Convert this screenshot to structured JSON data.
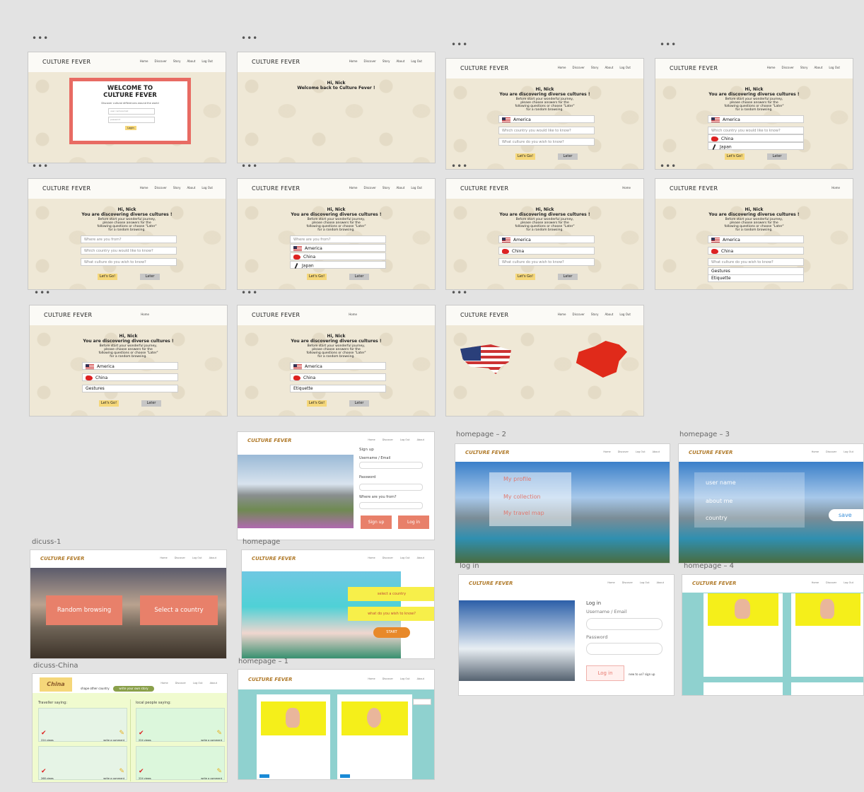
{
  "brand": "CULTURE FEVER",
  "brand_italic": "CULTURE FEVER",
  "dots": "•••",
  "nav_full": [
    "Home",
    "Discover",
    "Story",
    "About",
    "Log Out"
  ],
  "nav_home": "Home",
  "welcome": {
    "title_line1": "WELCOME TO",
    "title_line2": "CULTURE FEVER",
    "subtitle": "Discover cultural differences around the world",
    "username_ph": "user name/email",
    "password_ph": "password",
    "login": "Login"
  },
  "greeting": {
    "hi": "Hi, Nick",
    "welcome_back": "Welcome back to Culture Fever !",
    "discover": "You are discovering diverse cultures !",
    "desc": "Before start your wonderful journey, please choose answers for the following questions or choose \"Later\" for a random browsing."
  },
  "fields": {
    "where": "Where are you from?",
    "which": "Which country you would like to know?",
    "what": "What culture do you wish to know?"
  },
  "options": {
    "america": "America",
    "china": "China",
    "japan": "Japan",
    "gestures": "Gestures",
    "etiquette": "Etiquette"
  },
  "buttons": {
    "go": "Let's Go!",
    "later": "Later"
  },
  "labels": {
    "homepage2": "homepage – 2",
    "homepage3": "homepage – 3",
    "dicuss1": "dicuss-1",
    "homepage": "homepage",
    "login": "log in",
    "homepage4": "homepage – 4",
    "dicussChina": "dicuss-China",
    "homepage1": "homepage – 1"
  },
  "signup": {
    "title": "Sign up",
    "user": "Username / Email",
    "password": "Password",
    "where": "Where are you from?",
    "signup_btn": "Sign up",
    "login_btn": "Log in"
  },
  "menu": {
    "profile": "My profile",
    "collection": "My collection",
    "travel": "My travel map"
  },
  "profile_form": {
    "user": "user name",
    "about": "about me",
    "country": "country",
    "save": "save"
  },
  "discuss": {
    "random": "Random browsing",
    "select": "Select a country"
  },
  "homepage": {
    "select": "select a country",
    "what": "what do you wish to know?",
    "start": "START"
  },
  "login": {
    "title": "Log in",
    "user": "Username / Email",
    "password": "Password",
    "btn": "Log in",
    "new": "new to us? sign up"
  },
  "china": {
    "title": "China",
    "other": "shape other country",
    "write": "write your own story",
    "traveler": "Traveller saying:",
    "local": "local people saying:",
    "views1": "224 views",
    "views2": "268 views",
    "comment": "write a comment"
  }
}
